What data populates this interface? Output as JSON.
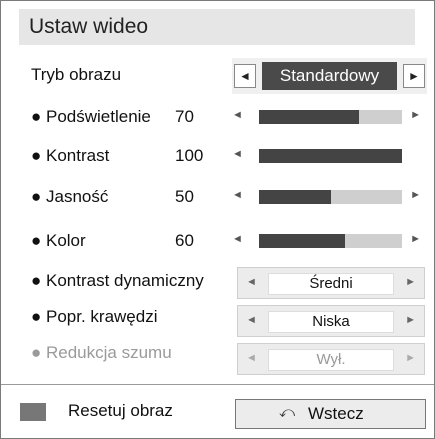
{
  "title": "Ustaw wideo",
  "mode": {
    "label": "Tryb obrazu",
    "value": "Standardowy",
    "left_arrow": "◄",
    "right_arrow": "►"
  },
  "sliders": [
    {
      "label": "● Podświetlenie",
      "value": "70",
      "level": 0.7,
      "left_arrow": "◄",
      "right_arrow": "►"
    },
    {
      "label": "● Kontrast",
      "value": "100",
      "level": 1.0,
      "left_arrow": "◄",
      "right_arrow": ""
    },
    {
      "label": "● Jasność",
      "value": "50",
      "level": 0.5,
      "left_arrow": "◄",
      "right_arrow": "►"
    },
    {
      "label": "● Kolor",
      "value": "60",
      "level": 0.6,
      "left_arrow": "◄",
      "right_arrow": "►"
    }
  ],
  "options": [
    {
      "label": "● Kontrast dynamiczny",
      "value": "Średni",
      "left_arrow": "◄",
      "right_arrow": "►",
      "enabled": true
    },
    {
      "label": "● Popr. krawędzi",
      "value": "Niska",
      "left_arrow": "◄",
      "right_arrow": "►",
      "enabled": true
    },
    {
      "label": "● Redukcja szumu",
      "value": "Wył.",
      "left_arrow": "◄",
      "right_arrow": "►",
      "enabled": false
    }
  ],
  "footer": {
    "reset_label": "Resetuj obraz",
    "back_label": "Wstecz",
    "back_icon": "return-arrow-icon",
    "back_glyph": "⤺"
  },
  "colors": {
    "selection": "#4a4a4a",
    "title_bg": "#e6e6e6",
    "track_fill": "#444444",
    "track_bg": "#cfcfcf"
  }
}
